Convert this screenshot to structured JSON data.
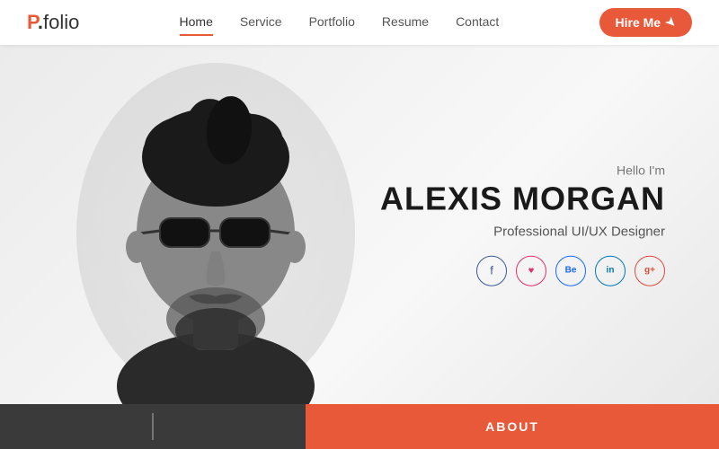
{
  "logo": {
    "p": "P",
    "dot": ".",
    "folio": "folio"
  },
  "nav": {
    "links": [
      {
        "label": "Home",
        "active": true
      },
      {
        "label": "Service",
        "active": false
      },
      {
        "label": "Portfolio",
        "active": false
      },
      {
        "label": "Resume",
        "active": false
      },
      {
        "label": "Contact",
        "active": false
      }
    ],
    "hire_btn": "Hire Me"
  },
  "hero": {
    "hello": "Hello I'm",
    "name": "ALEXIS MORGAN",
    "title": "Professional UI/UX Designer"
  },
  "social": [
    {
      "icon": "f",
      "name": "facebook",
      "label": "Facebook"
    },
    {
      "icon": "♡",
      "name": "instagram",
      "label": "Instagram"
    },
    {
      "icon": "Be",
      "name": "behance",
      "label": "Behance"
    },
    {
      "icon": "in",
      "name": "linkedin",
      "label": "LinkedIn"
    },
    {
      "icon": "g+",
      "name": "googleplus",
      "label": "Google Plus"
    }
  ],
  "bottom": {
    "about_label": "ABOUT"
  },
  "colors": {
    "accent": "#e8593a",
    "dark": "#3a3a3a",
    "text_primary": "#1a1a1a",
    "text_secondary": "#555"
  }
}
